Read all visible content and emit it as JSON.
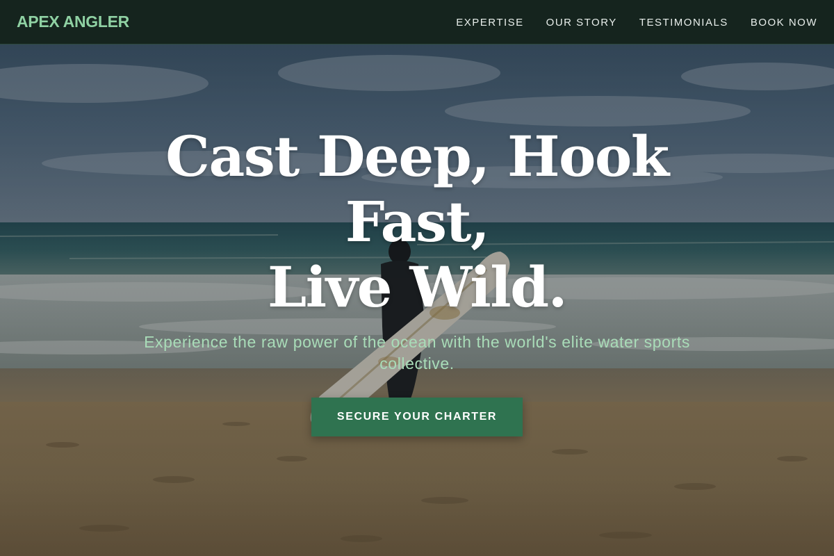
{
  "brand": {
    "name": "APEX ANGLER"
  },
  "nav": {
    "items": [
      {
        "label": "EXPERTISE"
      },
      {
        "label": "OUR STORY"
      },
      {
        "label": "TESTIMONIALS"
      },
      {
        "label": "BOOK NOW"
      }
    ]
  },
  "hero": {
    "headline_lines": [
      "Cast Deep, Hook",
      "Fast,",
      "Live Wild."
    ],
    "subtitle": "Experience the raw power of the ocean with the world's elite water sports collective.",
    "cta_label": "SECURE YOUR CHARTER",
    "background_icon": "beach-surfer-photo"
  },
  "colors": {
    "nav_bg": "#15241e",
    "brand": "#8fd1a3",
    "nav_text": "#e9efec",
    "headline": "#ffffff",
    "subtitle": "#a9dcb8",
    "cta_bg": "#2f7350",
    "cta_text": "#ffffff"
  }
}
